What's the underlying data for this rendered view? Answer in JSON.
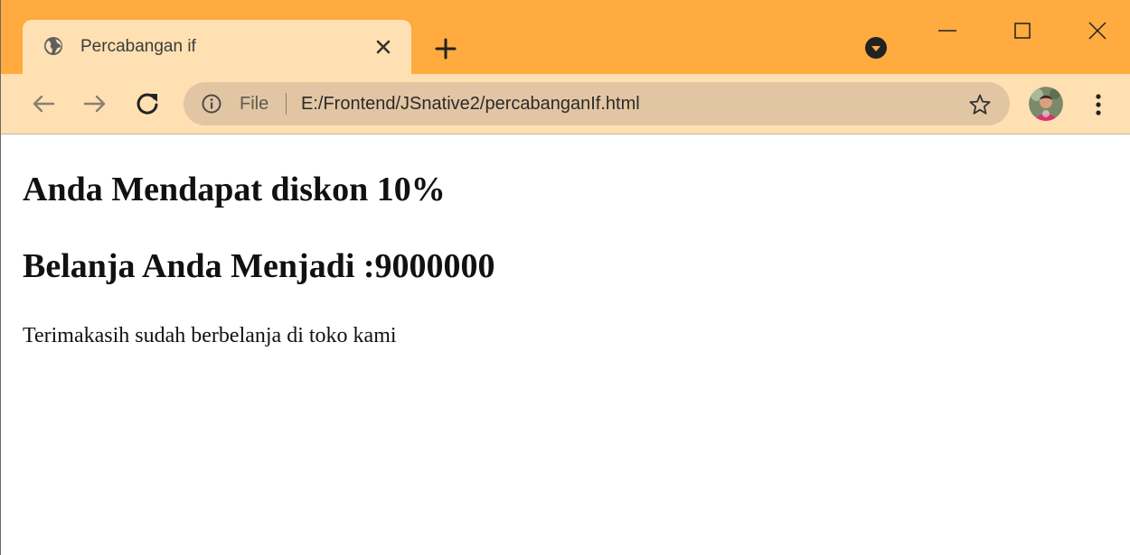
{
  "browser": {
    "tab": {
      "title": "Percabangan if",
      "favicon": "globe-icon",
      "close_icon": "close-icon"
    },
    "new_tab_icon": "plus-icon",
    "profile_menu_icon": "chevron-down-circle-icon",
    "window_controls": [
      "minimize-icon",
      "maximize-icon",
      "close-icon"
    ],
    "colors": {
      "tabstrip": "#ffab40",
      "toolbar": "#ffe0b2",
      "omnibox": "#e2c6a3"
    }
  },
  "toolbar": {
    "back_icon": "arrow-left-icon",
    "forward_icon": "arrow-right-icon",
    "reload_icon": "reload-icon",
    "omnibox": {
      "info_icon": "info-icon",
      "scheme_label": "File",
      "url": "E:/Frontend/JSnative2/percabanganIf.html",
      "bookmark_icon": "star-icon"
    },
    "avatar_icon": "avatar",
    "menu_icon": "kebab-menu-icon"
  },
  "page": {
    "heading1": "Anda Mendapat diskon 10%",
    "heading2": "Belanja Anda Menjadi :9000000",
    "paragraph": "Terimakasih sudah berbelanja di toko kami"
  }
}
